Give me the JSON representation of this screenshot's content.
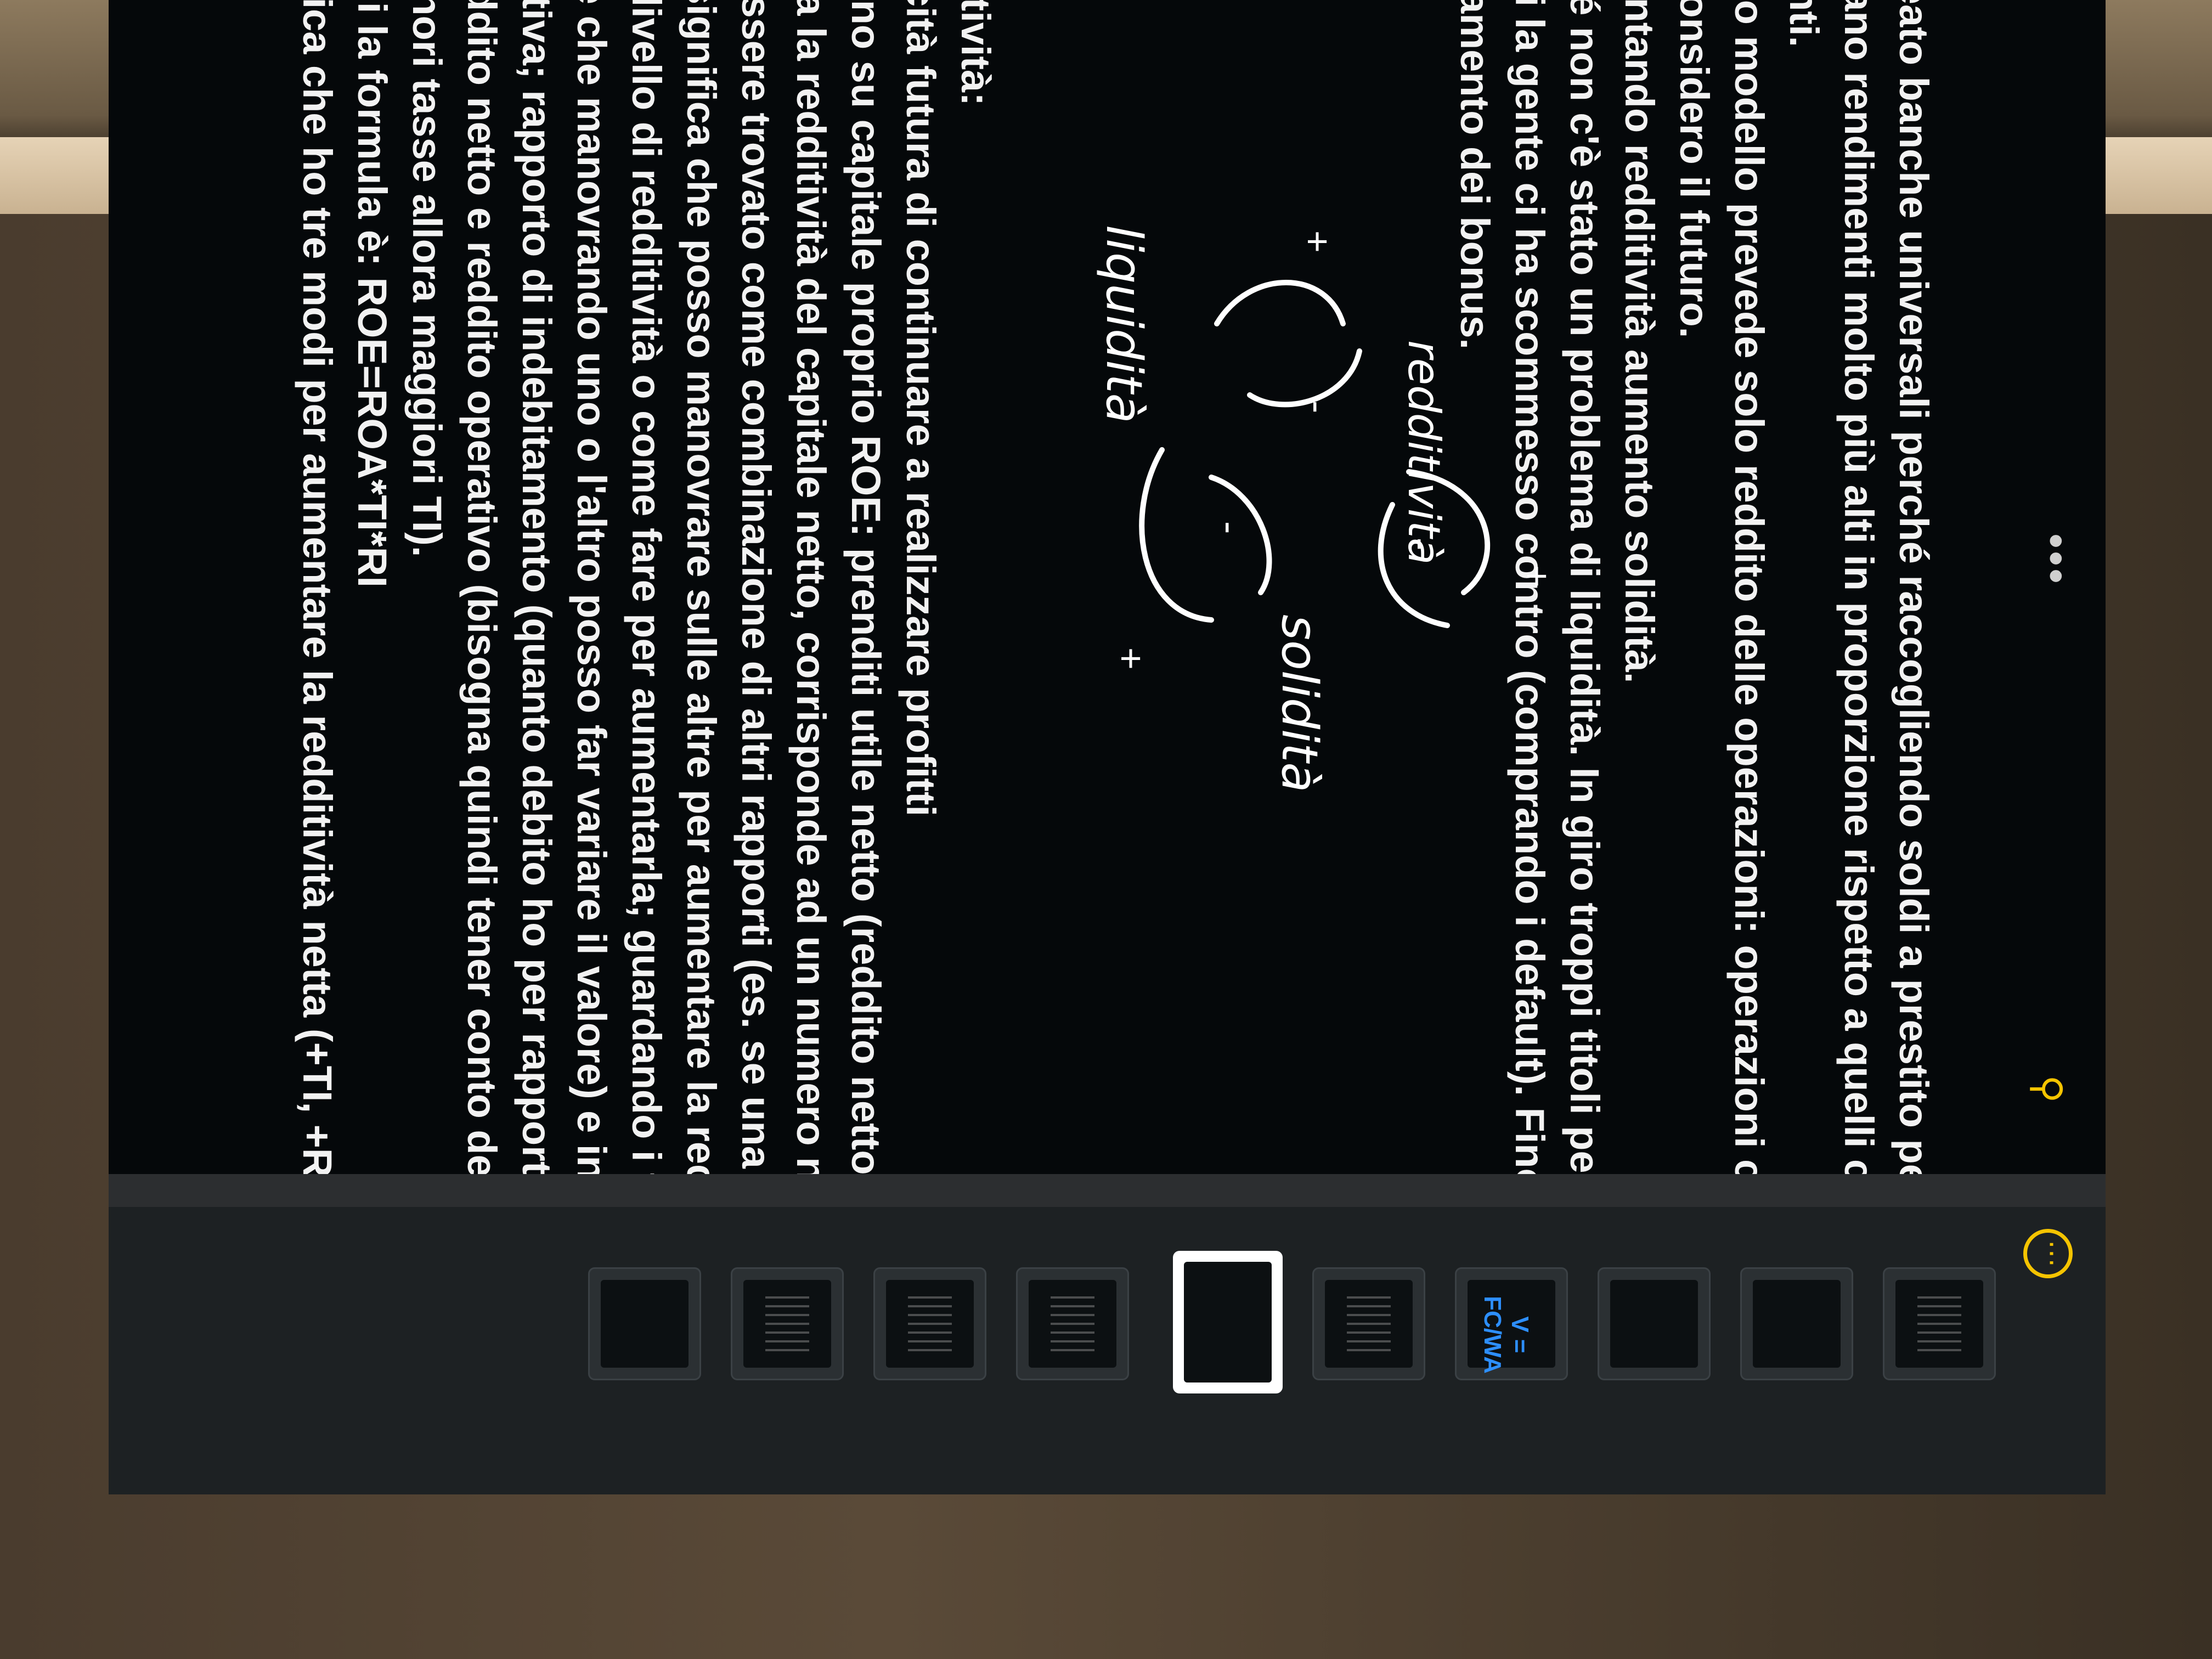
{
  "toolbar": {
    "expand_icon": "expand-icon",
    "more_icon": "more-icon",
    "more_label": "•••",
    "tune_icon": "tune-icon",
    "camera_icon": "camera-icon"
  },
  "note": {
    "paragraph1": [
      "ha creato banche universali perché raccogliendo soldi a prestito per finanziare diverse op",
      "facevano rendimenti molto più alti in proporzione rispetto a quelli che faceva gestendo i c",
      "correnti.",
      "Questo modello prevede solo reddito delle operazioni: operazioni con cliente una volta so",
      "non considero il futuro.",
      "Aumentando redditività aumento solidità.",
      "Finché non c'è stato un problema di liquidità. In giro troppi titoli per un volume totale ecce",
      "quindi la gente ci ha scommesso contro (comprando i default). Fino a quando la banca p",
      "il pagamento dei bonus."
    ],
    "diagram": {
      "node_top": "redditività",
      "node_left": "liquidità",
      "node_right": "solidità",
      "sign_plus": "+",
      "sign_minus": "-"
    },
    "paragraph2": [
      "Redditività:",
      "Capacità futura di continuare a realizzare profitti",
      "–  ritorno su capitale proprio ROE: prenditi utile netto (reddito netto) diviso il capitale",
      "Misura la redditività del capitale netto, corrisponde ad un numero non una percentuale",
      "Può essere trovato come combinazione di altri rapporti (es. se una redditività è la comb",
      "altre significa che posso manovrare sulle altre per aumentare la redditività e capire le c",
      "certo livello di redditività o come fare per aumentarla; guardando i fattori che la deterr",
      "capire che manovrando uno o l'altro posso far variare il valore) e in questo caso sono:",
      "operativa; rapporto di indebitamento (quanto debito ho per rapporto al capitale propri",
      "fra reddito netto e reddito operativo (bisogna quindi tener conto delle tasse: maggiore",
      "TI, minori tasse allora maggiori TI).",
      "Quindi la formula è: ROE=ROA*TI*RI",
      "Significa che ho tre modi per aumentare la redditività netta (+TI, +RI oppure +ROA)"
    ]
  },
  "sidebar": {
    "menu_icon": "ellipsis-circle-icon",
    "menu_label": "⋯",
    "thumbnails": [
      {
        "name": "page-thumb-1",
        "label": ""
      },
      {
        "name": "page-thumb-2",
        "label": ""
      },
      {
        "name": "page-thumb-3",
        "label": ""
      },
      {
        "name": "page-thumb-4",
        "label": "V = FC/WA"
      },
      {
        "name": "page-thumb-5",
        "label": ""
      },
      {
        "name": "page-thumb-6",
        "label": "",
        "active": true
      },
      {
        "name": "page-thumb-7",
        "label": ""
      },
      {
        "name": "page-thumb-8",
        "label": ""
      },
      {
        "name": "page-thumb-9",
        "label": ""
      },
      {
        "name": "page-thumb-10",
        "label": ""
      }
    ]
  },
  "colors": {
    "accent": "#f5c400",
    "background": "#05080a",
    "text": "#f2f2f2",
    "sidebar": "#1d2123",
    "formula_blue": "#2d8fff"
  }
}
